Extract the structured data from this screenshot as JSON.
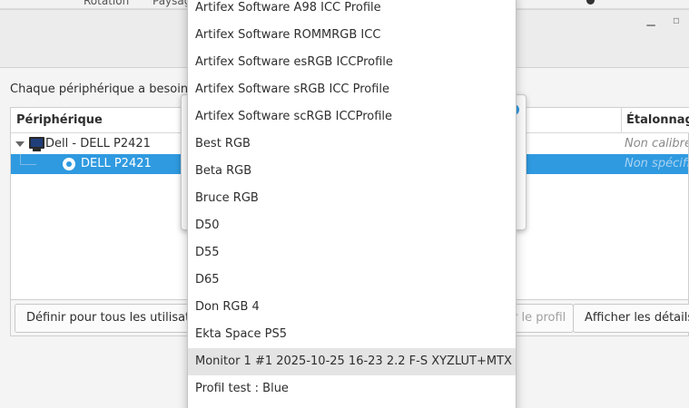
{
  "window": {
    "intro_text": "Chaque périphérique a besoin d'",
    "top_strip": [
      "Rotation",
      "Paysage"
    ]
  },
  "device_list": {
    "columns": {
      "device": "Périphérique",
      "calibration": "Étalonnage"
    },
    "rows": [
      {
        "label": "Dell - DELL P2421",
        "calibration": "Non calibré"
      },
      {
        "label": "DELL P2421",
        "calibration": "Non spécifié"
      }
    ]
  },
  "buttons": {
    "set_all": "Définir pour tous les utilisateurs",
    "profile": "r le profil",
    "details": "Afficher les détails"
  },
  "profile_menu": {
    "items": [
      "Artifex Software A98 ICC Profile",
      "Artifex Software ROMMRGB ICC",
      "Artifex Software esRGB ICCProfile",
      "Artifex Software sRGB ICC Profile",
      "Artifex Software scRGB ICCProfile",
      "Best RGB",
      "Beta RGB",
      "Bruce RGB",
      "D50",
      "D55",
      "D65",
      "Don RGB 4",
      "Ekta Space PS5",
      "Monitor 1 #1 2025-10-25 16-23 2.2 F-S XYZLUT+MTX",
      "Profil test : Blue"
    ],
    "hovered_index": 13
  },
  "colors": {
    "selection": "#2f9ae0",
    "menu_hover": "#e4e4e4"
  }
}
